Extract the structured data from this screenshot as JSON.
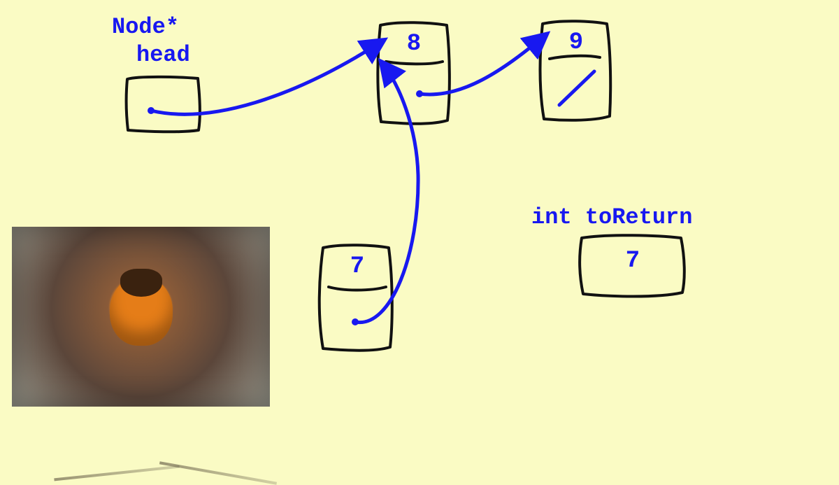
{
  "head_label_line1": "Node*",
  "head_label_line2": "head",
  "node8_value": "8",
  "node9_value": "9",
  "node7_value": "7",
  "toReturn_label": "int toReturn",
  "toReturn_value": "7",
  "colors": {
    "ink": "#1818f0",
    "stroke": "#111111",
    "bg": "#fafbc4"
  },
  "photo_subject": "hornet-insect-closeup"
}
